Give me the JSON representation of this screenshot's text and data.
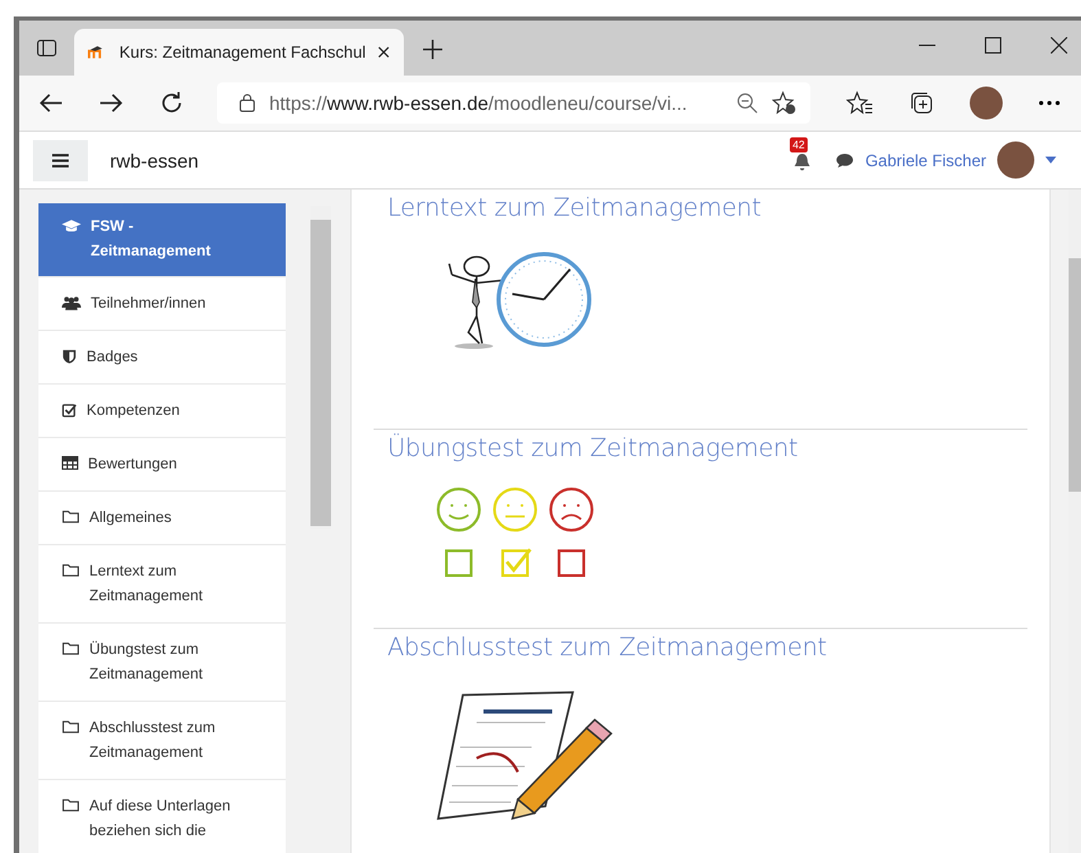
{
  "browser": {
    "tab_title": "Kurs: Zeitmanagement Fachschul",
    "url_prefix": "https://",
    "url_domain": "www.rwb-essen.de",
    "url_path": "/moodleneu/course/vi..."
  },
  "header": {
    "site_name": "rwb-essen",
    "notification_count": "42",
    "user_name": "Gabriele Fischer"
  },
  "sidebar": {
    "items": [
      {
        "label": "FSW - Zeitmanagement",
        "kind": "course",
        "selected": true
      },
      {
        "label": "Teilnehmer/innen",
        "kind": "users",
        "selected": false
      },
      {
        "label": "Badges",
        "kind": "badge",
        "selected": false
      },
      {
        "label": "Kompetenzen",
        "kind": "check",
        "selected": false
      },
      {
        "label": "Bewertungen",
        "kind": "table",
        "selected": false
      },
      {
        "label": "Allgemeines",
        "kind": "folder",
        "selected": false
      },
      {
        "label": "Lerntext zum Zeitmanagement",
        "kind": "folder",
        "selected": false
      },
      {
        "label": "Übungstest zum Zeitmanagement",
        "kind": "folder",
        "selected": false
      },
      {
        "label": "Abschlusstest zum Zeitmanagement",
        "kind": "folder",
        "selected": false
      },
      {
        "label": "Auf diese Unterlagen beziehen sich die",
        "kind": "folder",
        "selected": false
      }
    ]
  },
  "sections": [
    {
      "title": "Lerntext zum Zeitmanagement",
      "kind": "clock"
    },
    {
      "title": "Übungstest zum Zeitmanagement",
      "kind": "smileys"
    },
    {
      "title": "Abschlusstest zum Zeitmanagement",
      "kind": "test"
    }
  ]
}
